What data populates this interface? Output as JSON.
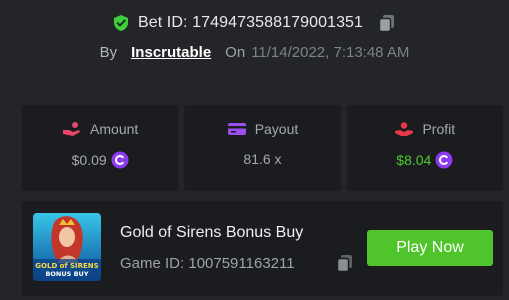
{
  "bet": {
    "id_label": "Bet ID: 1749473588179001351",
    "by_label": "By",
    "user": "Inscrutable",
    "on_label": "On",
    "date": "11/14/2022, 7:13:48 AM"
  },
  "stats": {
    "amount": {
      "label": "Amount",
      "value": "$0.09",
      "icon": "coins-hand-icon"
    },
    "payout": {
      "label": "Payout",
      "value": "81.6 x",
      "icon": "card-icon"
    },
    "profit": {
      "label": "Profit",
      "value": "$8.04",
      "icon": "hand-money-icon"
    }
  },
  "game": {
    "title": "Gold of Sirens Bonus Buy",
    "id_label": "Game ID: 1007591163211",
    "thumb_text_line1": "GOLD of SIRENS",
    "thumb_text_line2": "BONUS BUY",
    "play_label": "Play Now"
  },
  "colors": {
    "background": "#232529",
    "card": "#1b1c1f",
    "accent_green": "#4fc42b",
    "profit_green": "#4ccd2a",
    "coin_purple": "#8b3cf0",
    "amount_icon": "#e8476b",
    "payout_icon": "#9b4ff0",
    "profit_icon": "#e6394a"
  }
}
